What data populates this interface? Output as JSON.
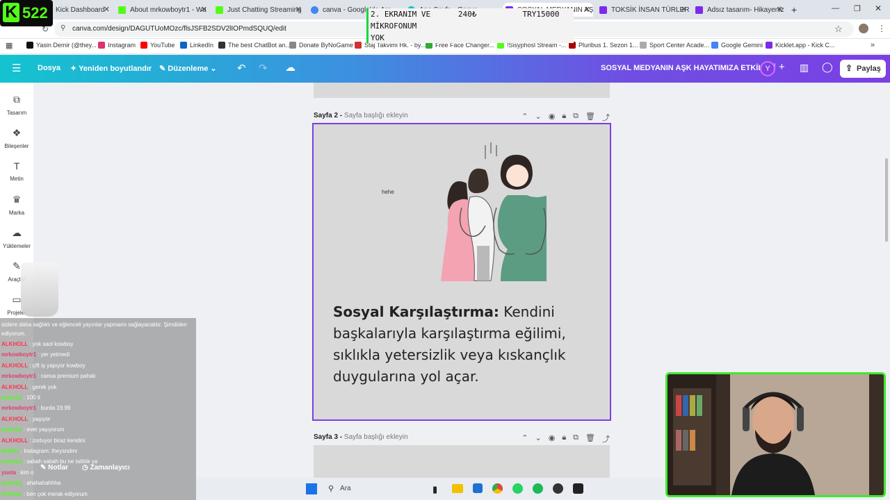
{
  "logo": {
    "text": "522"
  },
  "tabs": [
    {
      "label": "Kick Dashboard",
      "color": "#53fc18"
    },
    {
      "label": "About mrkowboytr1 - Wa",
      "color": "#53fc18"
    },
    {
      "label": "Just Chatting Streaming",
      "color": "#53fc18"
    },
    {
      "label": "canva - Google'da Ara",
      "color": "#4285f4"
    },
    {
      "label": "Ana Sayfa - Canva",
      "color": "#00c4cc"
    },
    {
      "label": "SOSYAL MEDYANIN AŞK",
      "color": "#7d2ae8"
    },
    {
      "label": "TOKSİK İNSAN TÜRLERİ",
      "color": "#7d2ae8"
    },
    {
      "label": "Adsız tasarım- Hikayeniz",
      "color": "#7d2ae8"
    }
  ],
  "address": {
    "url": "canva.com/design/DAGUTUoMOzc/flsJSFB2SDV2lIOPmdSQUQ/edit"
  },
  "bookmarks": [
    {
      "label": "Yasin Demir (@they...",
      "color": "#111"
    },
    {
      "label": "Instagram",
      "color": "#e1306c"
    },
    {
      "label": "YouTube",
      "color": "#ff0000"
    },
    {
      "label": "LinkedIn",
      "color": "#0a66c2"
    },
    {
      "label": "The best ChatBot an...",
      "color": "#333"
    },
    {
      "label": "Donate ByNoGame",
      "color": "#888"
    },
    {
      "label": "Staj Takvimi Hk. - by...",
      "color": "#c33"
    },
    {
      "label": "Free Face Changer...",
      "color": "#3a3"
    },
    {
      "label": "!Sisyphosl Stream -...",
      "color": "#53fc18"
    },
    {
      "label": "Pluribus 1. Sezon 1...",
      "color": "#a00"
    },
    {
      "label": "Sport Center Acade...",
      "color": "#aaa"
    },
    {
      "label": "Google Gemini",
      "color": "#4285f4"
    },
    {
      "label": "Kicklet.app - Kick C...",
      "color": "#7d2ae8"
    }
  ],
  "toolbar": {
    "file": "Dosya",
    "resize": "Yeniden boyutlandır",
    "edit": "Düzenleme",
    "title": "SOSYAL MEDYANIN AŞK HAYATIMIZA ETKİLERİ",
    "avatar": "Y",
    "share": "Paylaş"
  },
  "sidebar": [
    {
      "label": "Tasarım",
      "icon": "⧉"
    },
    {
      "label": "Bileşenler",
      "icon": "❖"
    },
    {
      "label": "Metin",
      "icon": "T"
    },
    {
      "label": "Marka",
      "icon": "♛"
    },
    {
      "label": "Yüklemeler",
      "icon": "☁"
    },
    {
      "label": "Araçlar",
      "icon": "✎"
    },
    {
      "label": "Projeler",
      "icon": "▭"
    }
  ],
  "pages": {
    "page2_label": "Sayfa 2 -",
    "page2_placeholder": "Sayfa başlığı ekleyin",
    "page3_label": "Sayfa 3 -",
    "page3_placeholder": "Sayfa başlığı ekleyin"
  },
  "slide": {
    "heading": "Sosyal Karşılaştırma:",
    "body": " Kendini başkalarıyla karşılaştırma eğilimi, sıklıkla yetersizlik veya kıskançlık duygularına yol açar.",
    "hehe": "hehe"
  },
  "overlay": {
    "line1": "2. EKRANIM VE      240₺          TRY15000",
    "line2": "MİKROFONUM",
    "line3": "YOK"
  },
  "chat": {
    "top": "sizlere daha sağlıklı ve eğlenceli yayınlar yapmamı sağlayacaktır. Şimdiden",
    "top2": "ediyorum.",
    "messages": [
      {
        "user": "ALKHOLL",
        "text": ": yok saol kowboy",
        "color": "#ff3355"
      },
      {
        "user": "mrkowboytr1",
        "text": ": yer yetmedi",
        "color": "#e23c6e"
      },
      {
        "user": "ALKHOLL",
        "text": ": çift iş yapıyor kowboy",
        "color": "#ff3355"
      },
      {
        "user": "mrkowboytr1",
        "text": ": canva premium pahalı",
        "color": "#e23c6e"
      },
      {
        "user": "ALKHOLL",
        "text": ": gerek yok",
        "color": "#ff3355"
      },
      {
        "user": "byzkrkc",
        "text": ": 100 tl",
        "color": "#53fc18"
      },
      {
        "user": "mrkowboytr1",
        "text": ": burda 19.99",
        "color": "#e23c6e"
      },
      {
        "user": "ALKHOLL",
        "text": ": yaşıyor",
        "color": "#ff3355"
      },
      {
        "user": "byzkrkc",
        "text": ": evet yaşıyorum",
        "color": "#53fc18"
      },
      {
        "user": "ALKHOLL",
        "text": ": zorluyor biraz kendini",
        "color": "#ff3355"
      },
      {
        "user": "BotRix",
        "text": ": Instagram: theysndmr",
        "color": "#53fc18"
      },
      {
        "user": "byzkrkc",
        "text": ": sabah sabah bu ne tatlılık ya",
        "color": "#53fc18"
      },
      {
        "user": "yusta",
        "text": ": kim o",
        "color": "#e23c6e"
      },
      {
        "user": "byzkrkc",
        "text": ": ahahahahhha",
        "color": "#53fc18"
      },
      {
        "user": "byzkrkc",
        "text": ": ben çok merak ediyorum",
        "color": "#53fc18"
      }
    ]
  },
  "bottombar": {
    "notes": "Notlar",
    "timer": "Zamanlayıcı"
  },
  "taskbar": {
    "search": "Ara"
  }
}
